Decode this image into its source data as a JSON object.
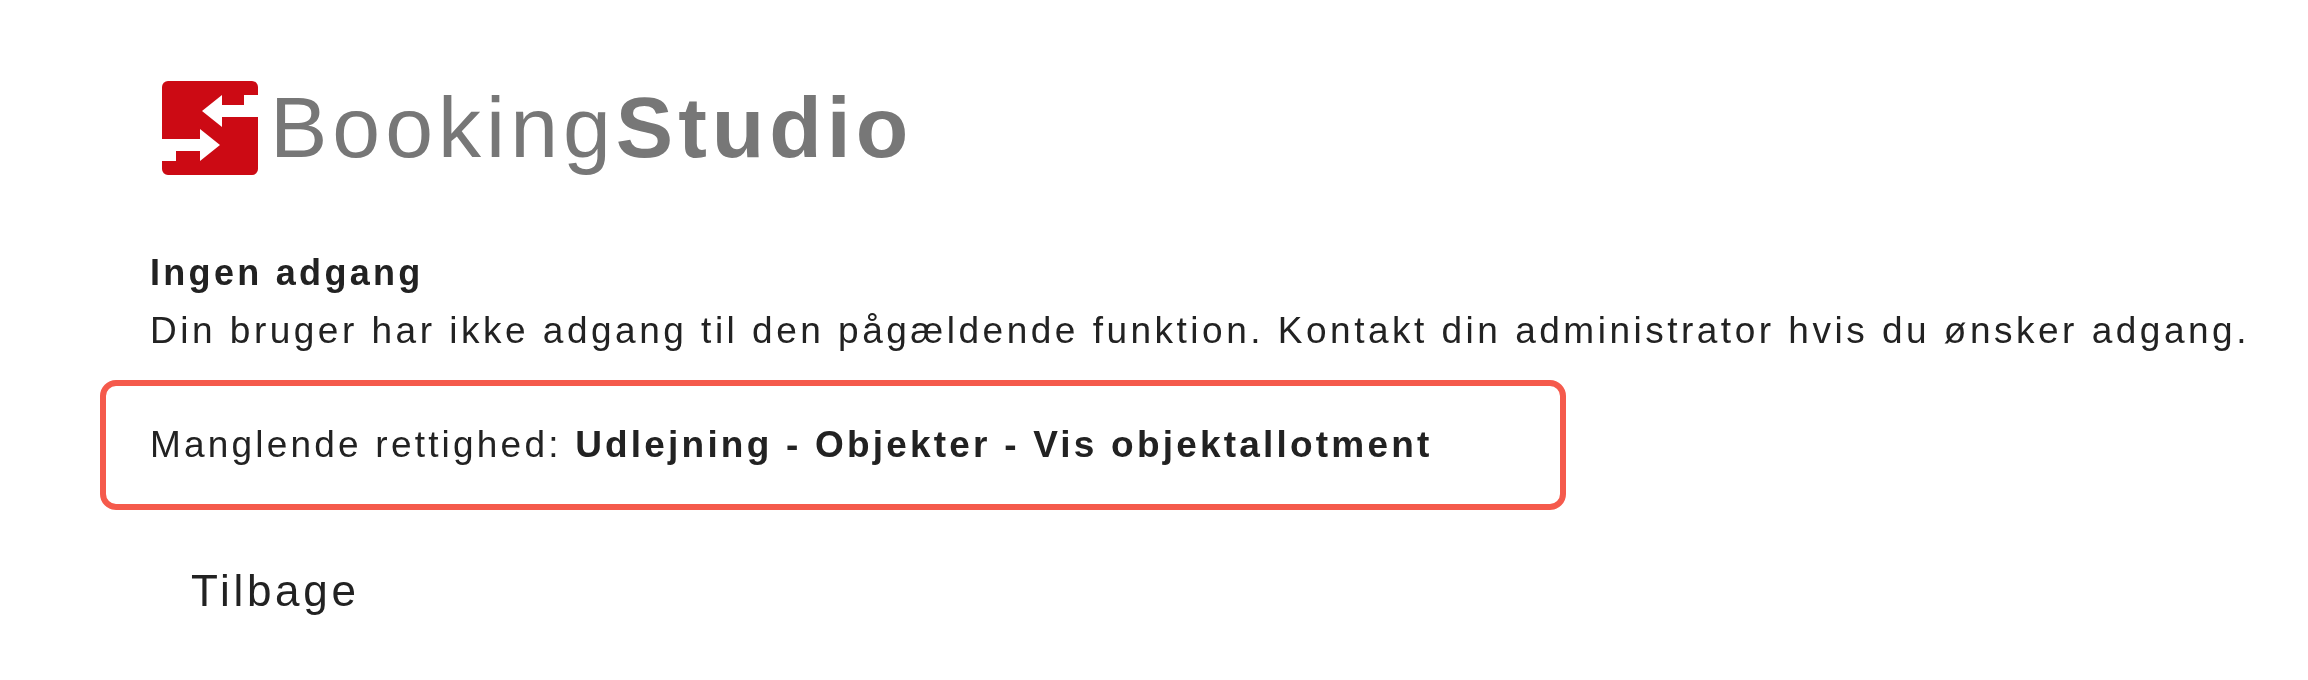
{
  "logo": {
    "text": "Booking**Studio**"
  },
  "message": {
    "title": "Ingen adgang",
    "body": "Din bruger har ikke adgang til den pågældende funktion. Kontakt din administrator hvis du ønsker adgang.",
    "missing_permission": "Manglende rettighed: **Udlejning - Objekter - Vis objektallotment**"
  },
  "back_link": "Tilbage"
}
